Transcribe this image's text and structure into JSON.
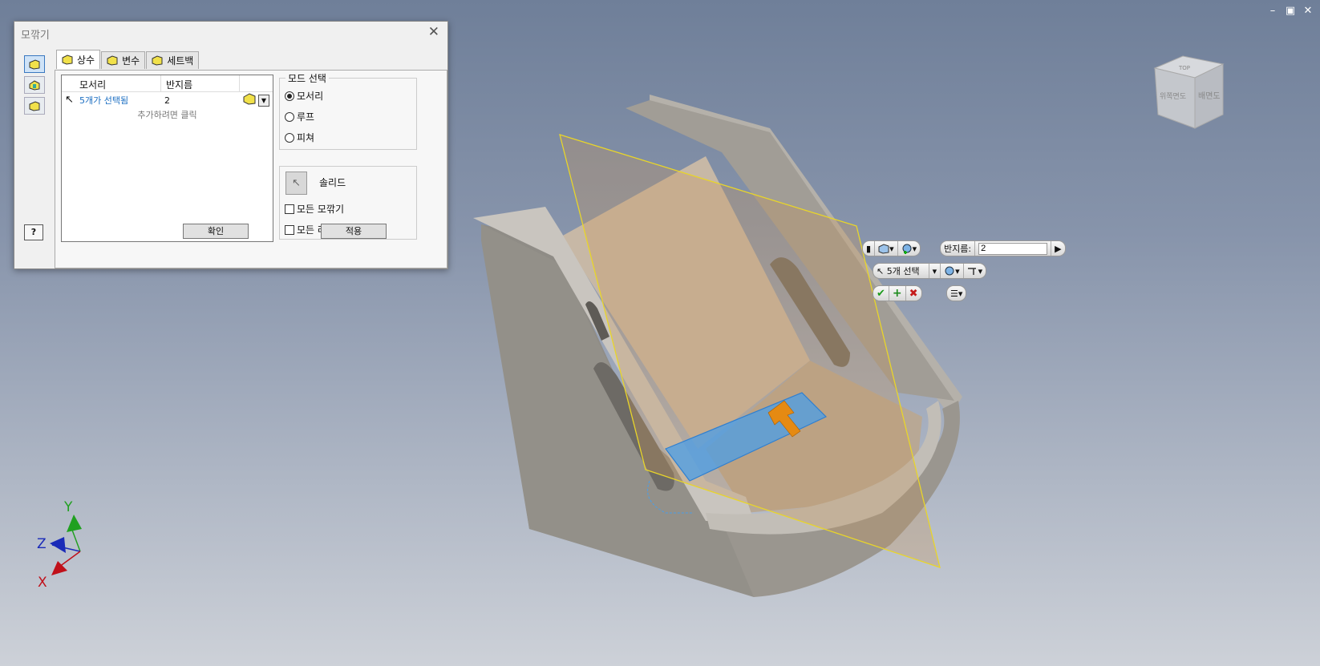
{
  "window_controls": [
    "–",
    "▣",
    "✕"
  ],
  "dialog": {
    "title": "모깎기",
    "close": "✕",
    "help": "?",
    "tabs": [
      {
        "label": "상수",
        "active": true
      },
      {
        "label": "변수",
        "active": false
      },
      {
        "label": "세트백",
        "active": false
      }
    ],
    "table": {
      "col_edge": "모서리",
      "col_radius": "반지름",
      "row": {
        "edge": "5개가 선택됨",
        "radius": "2"
      },
      "hint": "추가하려면 클릭"
    },
    "ok_label": "확인",
    "mode_group": {
      "title": "모드 선택",
      "options": [
        {
          "label": "모서리",
          "selected": true
        },
        {
          "label": "루프",
          "selected": false
        },
        {
          "label": "피쳐",
          "selected": false
        }
      ]
    },
    "solid_label": "솔리드",
    "chk_all_fillets": "모든 모깎기",
    "chk_all_rounds": "모든 라",
    "apply_label": "적용"
  },
  "mini_toolbar": {
    "radius_label": "반지름:",
    "radius_value": "2",
    "select_label": "5개 선택"
  },
  "viewcube": {
    "face_front": "위쪽면도",
    "face_right": "배면도",
    "face_top": "TOP"
  },
  "axes": {
    "x": "X",
    "y": "Y",
    "z": "Z",
    "x_color": "#c0101a",
    "y_color": "#20a020",
    "z_color": "#1a2ab8"
  },
  "colors": {
    "accent": "#1b6ec2",
    "selection": "#4a9ee8",
    "plane": "#c8965a"
  }
}
